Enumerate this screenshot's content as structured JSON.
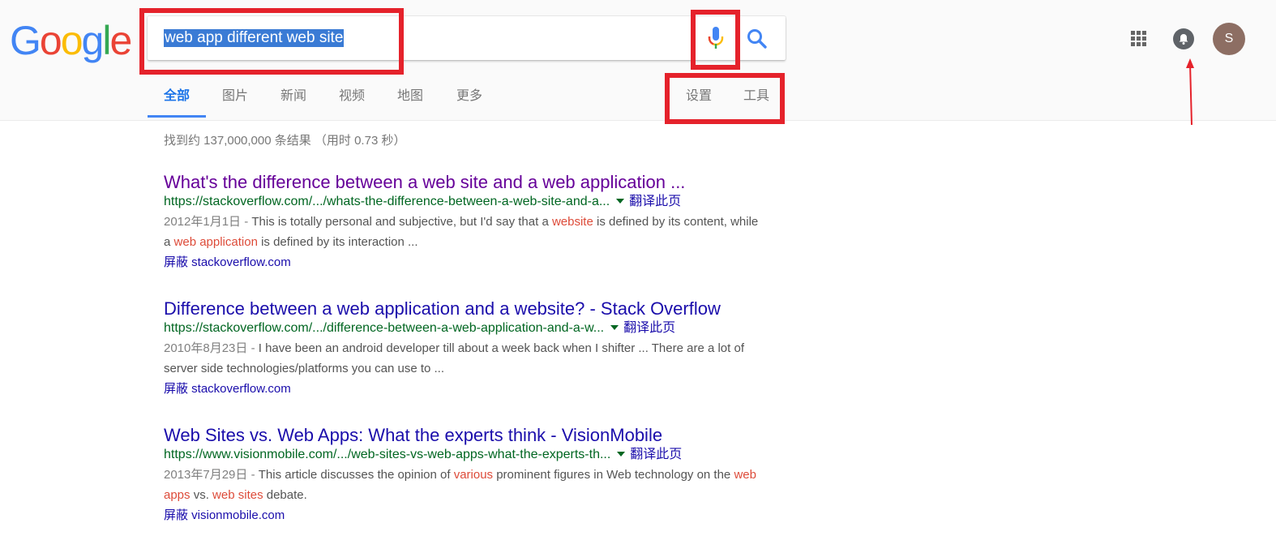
{
  "logo": {
    "letters": [
      "G",
      "o",
      "o",
      "g",
      "l",
      "e"
    ],
    "colors": [
      "#4285f4",
      "#ea4335",
      "#fbbc05",
      "#4285f4",
      "#34a853",
      "#ea4335"
    ]
  },
  "search": {
    "query": "web app different web site"
  },
  "tabs": [
    {
      "label": "全部",
      "active": true
    },
    {
      "label": "图片"
    },
    {
      "label": "新闻"
    },
    {
      "label": "视频"
    },
    {
      "label": "地图"
    },
    {
      "label": "更多"
    }
  ],
  "tools": {
    "settings": "设置",
    "tools": "工具"
  },
  "account": {
    "avatar_initial": "S"
  },
  "stats": "找到约 137,000,000 条结果 （用时 0.73 秒）",
  "results": [
    {
      "title": "What's the difference between a web site and a web application ...",
      "visited": true,
      "url": "https://stackoverflow.com/.../whats-the-difference-between-a-web-site-and-a...",
      "translate": "翻译此页",
      "date": "2012年1月1日 - ",
      "snippet_parts": [
        {
          "text": "This is totally personal and subjective, but I'd say that a ",
          "em": false
        },
        {
          "text": "website",
          "em": true
        },
        {
          "text": " is defined by its content, while a ",
          "em": false
        },
        {
          "text": "web application",
          "em": true
        },
        {
          "text": " is defined by its interaction ...",
          "em": false
        }
      ],
      "block": "屏蔽 stackoverflow.com"
    },
    {
      "title": "Difference between a web application and a website? - Stack Overflow",
      "visited": false,
      "url": "https://stackoverflow.com/.../difference-between-a-web-application-and-a-w...",
      "translate": "翻译此页",
      "date": "2010年8月23日 - ",
      "snippet_parts": [
        {
          "text": "I have been an android developer till about a week back when I shifter ... There are a lot of server side technologies/platforms you can use to ...",
          "em": false
        }
      ],
      "block": "屏蔽 stackoverflow.com"
    },
    {
      "title": "Web Sites vs. Web Apps: What the experts think - VisionMobile",
      "visited": false,
      "url": "https://www.visionmobile.com/.../web-sites-vs-web-apps-what-the-experts-th...",
      "translate": "翻译此页",
      "date": "2013年7月29日 - ",
      "snippet_parts": [
        {
          "text": "This article discusses the opinion of ",
          "em": false
        },
        {
          "text": "various",
          "em": true
        },
        {
          "text": " prominent figures in Web technology on the ",
          "em": false
        },
        {
          "text": "web apps",
          "em": true
        },
        {
          "text": " vs. ",
          "em": false
        },
        {
          "text": "web sites",
          "em": true
        },
        {
          "text": " debate.",
          "em": false
        }
      ],
      "block": "屏蔽 visionmobile.com"
    }
  ],
  "annotation": {
    "highlight_color": "#e5222b"
  }
}
